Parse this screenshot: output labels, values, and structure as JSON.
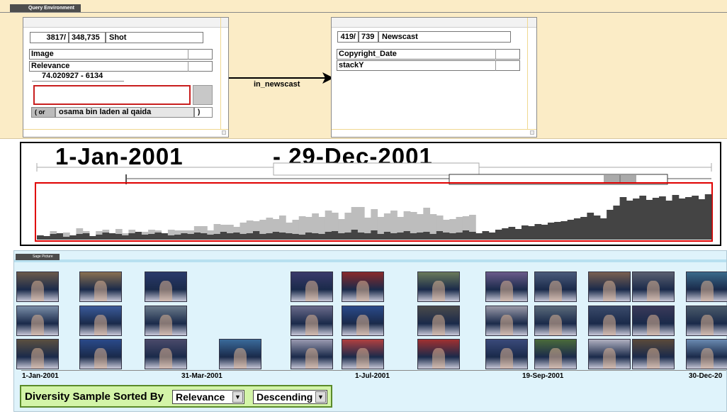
{
  "query_env": {
    "tab_label": "Query Environment",
    "shot_panel": {
      "count": "3817/",
      "total": "348,735",
      "entity": "Shot",
      "rows": [
        "Image",
        "Relevance"
      ],
      "range_text": "74.020927  - 6134",
      "or_label": "( or",
      "query_text": "osama bin laden al qaida",
      "close_paren": ")"
    },
    "relation_label": "in_newscast",
    "newscast_panel": {
      "count": "419/",
      "total": "739",
      "entity": "Newscast",
      "rows": [
        "Copyright_Date",
        "stackY"
      ]
    }
  },
  "timeline": {
    "start_date": "1-Jan-2001",
    "end_date": "- 29-Dec-2001",
    "histogram_dark": [
      6,
      5,
      8,
      9,
      4,
      6,
      8,
      9,
      5,
      7,
      10,
      9,
      8,
      6,
      9,
      11,
      7,
      8,
      10,
      9,
      6,
      7,
      9,
      8,
      10,
      9,
      7,
      8,
      11,
      9,
      10,
      8,
      9,
      12,
      8,
      9,
      11,
      10,
      9,
      8,
      7,
      10,
      9,
      8,
      11,
      12,
      9,
      10,
      14,
      10,
      9,
      13,
      8,
      11,
      9,
      10,
      12,
      9,
      10,
      11,
      8,
      12,
      10,
      9,
      10,
      13,
      11,
      9,
      12,
      10,
      14,
      16,
      18,
      15,
      20,
      19,
      22,
      21,
      24,
      25,
      26,
      28,
      30,
      32,
      38,
      34,
      30,
      42,
      48,
      60,
      55,
      58,
      62,
      56,
      59,
      61,
      55,
      63,
      58,
      60,
      62,
      57,
      64
    ],
    "histogram_light": [
      0,
      0,
      4,
      0,
      6,
      0,
      8,
      3,
      0,
      5,
      4,
      0,
      7,
      3,
      5,
      0,
      4,
      6,
      3,
      0,
      8,
      6,
      4,
      5,
      9,
      10,
      6,
      14,
      10,
      12,
      8,
      16,
      18,
      14,
      20,
      22,
      18,
      24,
      15,
      20,
      26,
      22,
      28,
      24,
      30,
      26,
      20,
      28,
      32,
      36,
      22,
      30,
      24,
      26,
      32,
      22,
      28,
      30,
      26,
      34,
      28,
      22,
      18,
      20,
      22,
      20,
      24,
      0,
      0,
      0,
      0,
      0,
      0,
      0,
      0,
      0,
      0,
      0,
      0,
      0,
      0,
      0,
      0,
      0,
      0,
      0,
      0,
      0,
      0,
      0,
      0,
      0,
      0,
      0,
      0,
      0,
      0,
      0,
      0,
      0,
      0,
      0,
      0
    ]
  },
  "sage": {
    "tab_label": "Sage Picture",
    "axis_dates": [
      "1-Jan-2001",
      "31-Mar-2001",
      "1-Jul-2001",
      "19-Sep-2001",
      "30-Dec-20"
    ],
    "thumb_colors": [
      "#6b5a4a",
      "#7a8ea8",
      "#5b5040",
      "#8a7050",
      "#3a5a9a",
      "#2a4a8a",
      "#2a3a6a",
      "#6a7a8a",
      "#4a4a6a",
      "#3a6a9a",
      "#3a3a6a",
      "#6a6a8a",
      "#9a9ab0",
      "#8a2a2a",
      "#2a4a8a",
      "#b04040",
      "#6a7a5a",
      "#4a4a4a",
      "#a03030",
      "#6a5a8a",
      "#9a9aa8",
      "#3a4a7a",
      "#4a5a7a",
      "#5a6a7a",
      "#4a6a3a",
      "#7a6050",
      "#3a4a6a",
      "#b0b0c0",
      "#5a6070",
      "#3a3a5a",
      "#5a4a3a",
      "#3a6a8a",
      "#4a5a6a",
      "#6a8ab0",
      "#6a5a4a",
      "#3a5a8a"
    ]
  },
  "diversity": {
    "label": "Diversity Sample Sorted By",
    "sort_field": "Relevance",
    "sort_order": "Descending"
  }
}
